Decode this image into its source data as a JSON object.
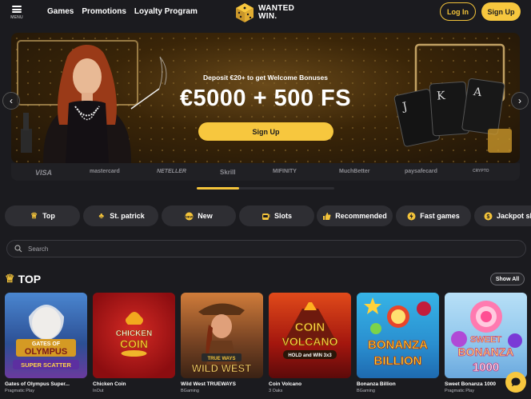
{
  "header": {
    "menu_label": "MENU",
    "nav": [
      "Games",
      "Promotions",
      "Loyalty Program"
    ],
    "logo_line1": "WANTED",
    "logo_line2": "WIN.",
    "login_label": "Log In",
    "signup_label": "Sign Up"
  },
  "banner": {
    "subtitle": "Deposit €20+ to get Welcome Bonuses",
    "headline": "€5000 + 500 FS",
    "cta_label": "Sign Up",
    "slide_position": 0.0
  },
  "payments": [
    "VISA",
    "mastercard",
    "NETELLER",
    "Skrill",
    "MIFINITY",
    "MuchBetter",
    "paysafecard",
    "CRYPTO"
  ],
  "categories": [
    {
      "label": "Top",
      "icon": "crown-icon"
    },
    {
      "label": "St. patrick",
      "icon": "clover-icon"
    },
    {
      "label": "New",
      "icon": "new-badge-icon"
    },
    {
      "label": "Slots",
      "icon": "slot-machine-icon"
    },
    {
      "label": "Recommended",
      "icon": "thumbs-up-icon"
    },
    {
      "label": "Fast games",
      "icon": "lightning-icon"
    },
    {
      "label": "Jackpot slots",
      "icon": "jackpot-icon"
    }
  ],
  "search": {
    "placeholder": "Search"
  },
  "section": {
    "title": "TOP",
    "show_all_label": "Show All"
  },
  "games": [
    {
      "name": "Gates of Olympus Super...",
      "provider": "Pragmatic Play",
      "art": "GATES OF OLYMPUS SUPER SCATTER",
      "bg": "#3d6fb8"
    },
    {
      "name": "Chicken Coin",
      "provider": "InOut",
      "art": "CHICKEN COIN",
      "bg": "#b5171a"
    },
    {
      "name": "Wild West TRUEWAYS",
      "provider": "BGaming",
      "art": "WILD WEST",
      "bg": "#7a4a26"
    },
    {
      "name": "Coin Volcano",
      "provider": "3 Oaks",
      "art": "COIN VOLCANO",
      "bg": "#c2261a"
    },
    {
      "name": "Bonanza Billion",
      "provider": "BGaming",
      "art": "BONANZA BILLION",
      "bg": "#2ea2d6"
    },
    {
      "name": "Sweet Bonanza 1000",
      "provider": "Pragmatic Play",
      "art": "SWEET BONANZA 1000",
      "bg": "#9fd0ef"
    }
  ],
  "colors": {
    "accent": "#f7c73e",
    "background": "#1b1b1f",
    "chip": "#2e2e33"
  }
}
